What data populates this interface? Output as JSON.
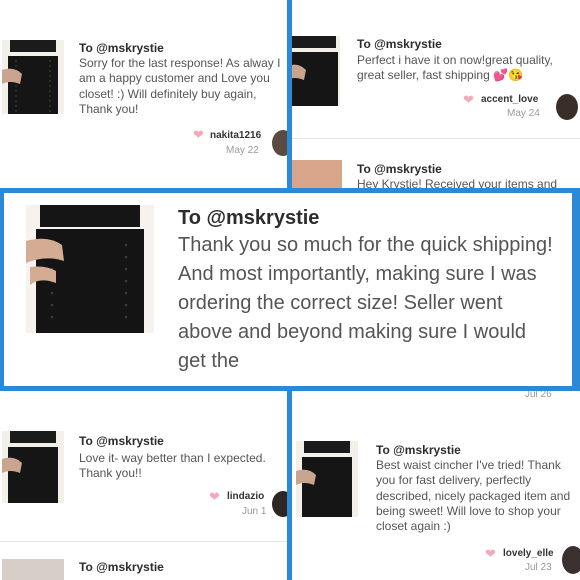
{
  "reviews": [
    {
      "to": "To @mskrystie",
      "message": "Sorry for the last response! As alway I am a happy customer and Love you closet! :) Will definitely buy again, Thank you!",
      "username": "nakita1216",
      "date": "May 22",
      "heart_icon": "heart-icon"
    },
    {
      "to": "To @mskrystie",
      "message": "Perfect i have it on now!great quality, great seller, fast shipping 💕😘",
      "username": "accent_love",
      "date": "May 24",
      "heart_icon": "heart-icon"
    },
    {
      "to": "To @mskrystie",
      "message": "Hey Krystie! Received your items and"
    },
    {
      "to": "To @mskrystie",
      "message": "Thank you so much for the quick shipping! And most importantly, making sure I was ordering the correct size! Seller went above and beyond making sure I would get the"
    },
    {
      "date": "Jul 26"
    },
    {
      "to": "To @mskrystie",
      "message": "Love it- way better than I expected. Thank you!!",
      "username": "lindazio",
      "date": "Jun 1",
      "heart_icon": "heart-icon"
    },
    {
      "to": "To @mskrystie"
    },
    {
      "to": "To @mskrystie",
      "message": "Best waist cincher I've tried! Thank you for fast delivery, perfectly described, nicely packaged item and being sweet! Will love to shop your closet again :)",
      "username": "lovely_elle",
      "date": "Jul 23",
      "heart_icon": "heart-icon"
    }
  ],
  "colors": {
    "background": "#2b8ad8",
    "heart": "#f4a9b8",
    "date": "#9a9a9a"
  }
}
